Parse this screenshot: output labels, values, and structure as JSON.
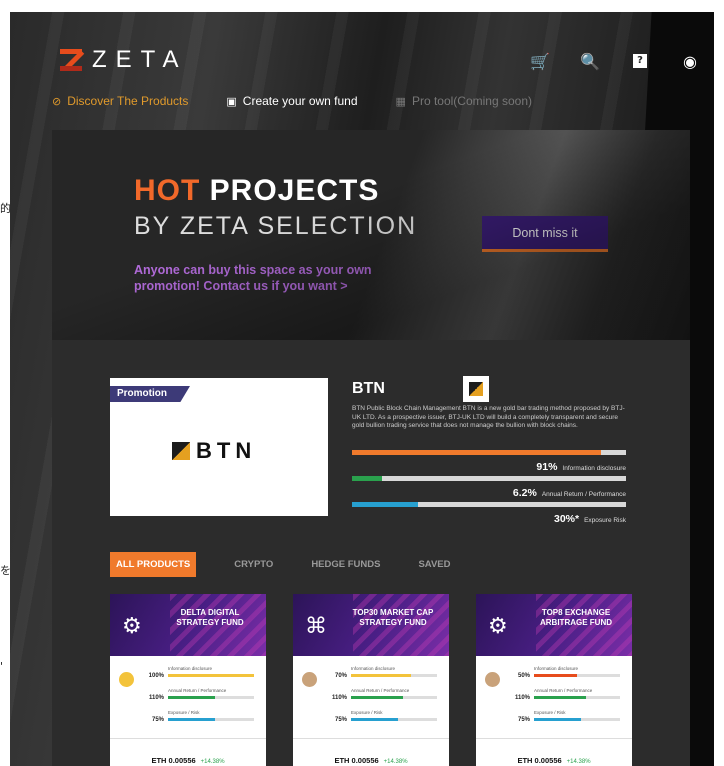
{
  "edge_marks": [
    "的",
    "を",
    "'"
  ],
  "header": {
    "logo_text": "ZETA",
    "icons": [
      "cart-icon",
      "search-icon",
      "help-icon",
      "profile-icon"
    ],
    "icon_glyphs": [
      "🛒",
      "🔍",
      "?",
      "◉"
    ]
  },
  "nav": [
    {
      "label": "Discover The Products",
      "icon": "⊘",
      "state": "active"
    },
    {
      "label": "Create your own fund",
      "icon": "▣",
      "state": "normal"
    },
    {
      "label": "Pro tool(Coming soon)",
      "icon": "▦",
      "state": "disabled"
    }
  ],
  "hero": {
    "title_hot": "HOT",
    "title_rest": " PROJECTS",
    "subtitle": "BY ZETA SELECTION",
    "promo_text": "Anyone can buy this space as your own promotion! Contact us if you want >",
    "cta_label": "Dont miss it"
  },
  "featured": {
    "tag": "Promotion",
    "logo_text": "BTN",
    "name": "BTN",
    "description": "BTN Public Block Chain Management\nBTN is a new gold bar trading method proposed by BTJ-UK LTD. As a prospective issuer, BTJ-UK LTD will build a completely transparent and secure gold bullion trading service that does not manage the bullion with block chains.",
    "metrics": [
      {
        "value": "91%",
        "label": "Information disclosure",
        "level": 0.91,
        "color": "#f07a2c"
      },
      {
        "value": "6.2%",
        "label": "Annual Return / Performance",
        "level": 0.11,
        "color": "#2aa14d"
      },
      {
        "value": "30%*",
        "label": "Exposure Risk",
        "level": 0.24,
        "color": "#27a0d0"
      }
    ]
  },
  "tabs": [
    "ALL PRODUCTS",
    "CRYPTO",
    "HEDGE FUNDS",
    "SAVED"
  ],
  "products": [
    {
      "title": "DELTA DIGITAL STRATEGY FUND",
      "icon": "⚙",
      "rows": [
        {
          "pct": "100%",
          "label": "Information disclosure",
          "level": 1.0,
          "color": "#f3c33b"
        },
        {
          "pct": "110%",
          "label": "Annual Return / Performance",
          "level": 0.55,
          "color": "#2aa14d"
        },
        {
          "pct": "75%",
          "label": "Exposure / Risk",
          "level": 0.55,
          "color": "#27a0d0"
        }
      ],
      "price": "ETH 0.00556",
      "change": "+14.38%"
    },
    {
      "title": "TOP30 MARKET CAP STRATEGY FUND",
      "icon": "⌘",
      "rows": [
        {
          "pct": "70%",
          "label": "Information disclosure",
          "level": 0.7,
          "color": "#f3c33b"
        },
        {
          "pct": "110%",
          "label": "Annual Return / Performance",
          "level": 0.6,
          "color": "#2aa14d"
        },
        {
          "pct": "75%",
          "label": "Exposure / Risk",
          "level": 0.55,
          "color": "#27a0d0"
        }
      ],
      "price": "ETH 0.00556",
      "change": "+14.38%"
    },
    {
      "title": "TOP8 EXCHANGE ARBITRAGE FUND",
      "icon": "⚙",
      "rows": [
        {
          "pct": "50%",
          "label": "Information disclosure",
          "level": 0.5,
          "color": "#e74c1c"
        },
        {
          "pct": "110%",
          "label": "Annual Return / Performance",
          "level": 0.6,
          "color": "#2aa14d"
        },
        {
          "pct": "75%",
          "label": "Exposure / Risk",
          "level": 0.55,
          "color": "#27a0d0"
        }
      ],
      "price": "ETH 0.00556",
      "change": "+14.38%"
    }
  ]
}
